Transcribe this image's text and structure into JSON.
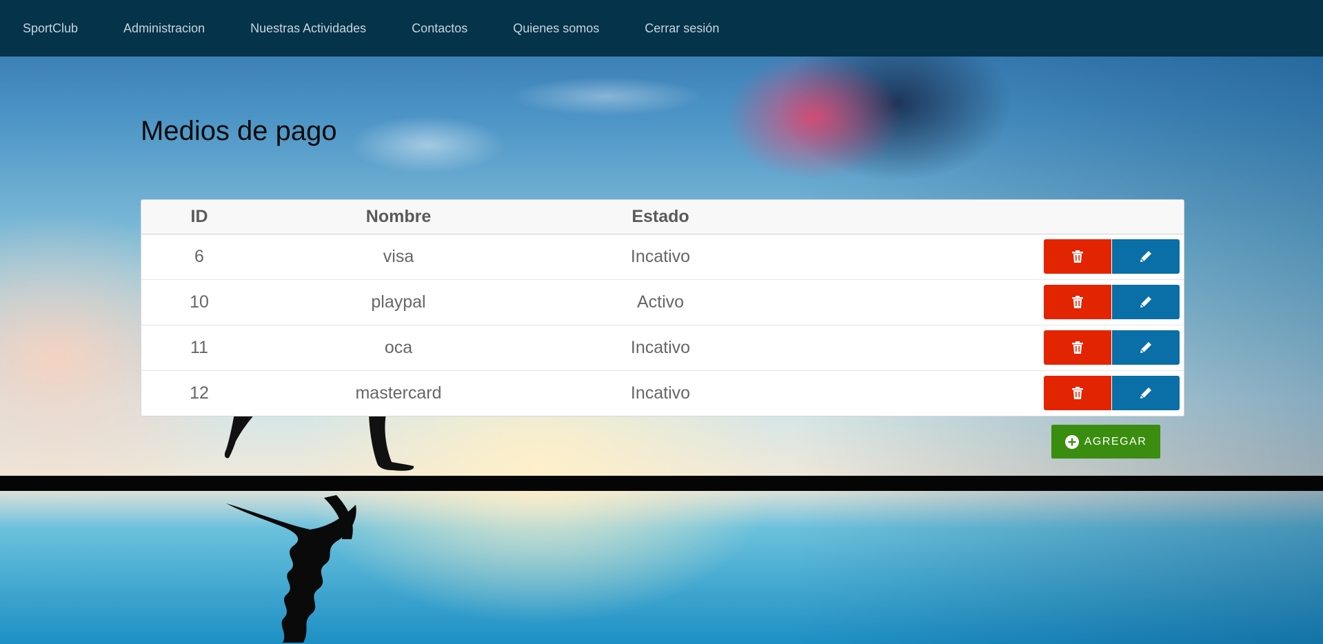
{
  "nav": {
    "items": [
      {
        "label": "SportClub"
      },
      {
        "label": "Administracion"
      },
      {
        "label": "Nuestras Actividades"
      },
      {
        "label": "Contactos"
      },
      {
        "label": "Quienes somos"
      },
      {
        "label": "Cerrar sesión"
      }
    ]
  },
  "page": {
    "title": "Medios de pago"
  },
  "table": {
    "headers": {
      "id": "ID",
      "name": "Nombre",
      "state": "Estado",
      "actions": ""
    },
    "rows": [
      {
        "id": "6",
        "name": "visa",
        "state": "Incativo"
      },
      {
        "id": "10",
        "name": "playpal",
        "state": "Activo"
      },
      {
        "id": "11",
        "name": "oca",
        "state": "Incativo"
      },
      {
        "id": "12",
        "name": "mastercard",
        "state": "Incativo"
      }
    ],
    "row_actions": {
      "delete_icon": "trash-icon",
      "edit_icon": "pencil-icon"
    }
  },
  "actions": {
    "add_label": "AGREGAR",
    "add_icon": "plus-circle-icon"
  },
  "colors": {
    "navbar": "#04334a",
    "delete": "#e32400",
    "edit": "#0a6fa6",
    "add": "#3a8d0e"
  }
}
